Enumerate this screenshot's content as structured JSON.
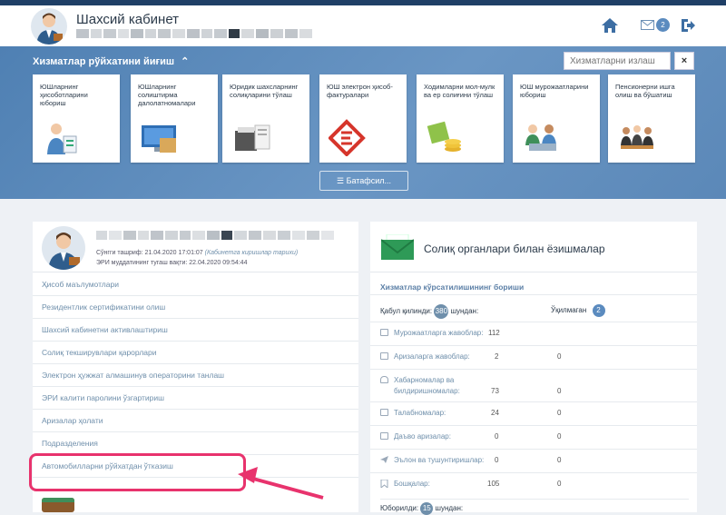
{
  "header": {
    "title": "Шахсий кабинет",
    "message_count": "2"
  },
  "banner": {
    "title": "Хизматлар рўйхатини йиғиш",
    "search_placeholder": "Хизматларни излаш",
    "close_label": "×",
    "more_label": "☰  Батафсил...",
    "cards": [
      {
        "label": "ЮШларнинг ҳисоботларини юбориш",
        "icon": "accountant-icon"
      },
      {
        "label": "ЮШларнинг солиштирма далолатномалари",
        "icon": "monitor-icon"
      },
      {
        "label": "Юридик шахсларнинг солиқларини тўлаш",
        "icon": "printer-icon"
      },
      {
        "label": "ЮШ электрон ҳисоб-фактуралари",
        "icon": "e-invoice-icon"
      },
      {
        "label": "Ходимларни мол-мулк ва ер солиғини тўлаш",
        "icon": "coins-icon"
      },
      {
        "label": "ЮШ мурожаатларини юбориш",
        "icon": "meeting-icon"
      },
      {
        "label": "Пенсионерни ишга олиш ва бўшатиш",
        "icon": "team-icon"
      }
    ]
  },
  "profile": {
    "last_visit": "Сўнгги ташриф: 21.04.2020 17:01:07",
    "last_visit_link": "(Кабинетга киришлар тарихи)",
    "eri_expiry": "ЭРИ муддатининг тугаш вақти: 22.04.2020 09:54:44"
  },
  "menu": [
    "Ҳисоб маълумотлари",
    "Резидентлик сертификатини олиш",
    "Шахсий кабинетни активлаштириш",
    "Солиқ текширувлари қарорлари",
    "Электрон ҳужжат алмашинув операторини танлаш",
    "ЭРИ калити паролини ўзгартириш",
    "Аризалар ҳолати",
    "Подразделения",
    "Автомобилларни рўйхатдан ўтказиш"
  ],
  "correspondence": {
    "title": "Солиқ органлари билан ёзишмалар",
    "subtitle": "Хизматлар кўрсатилишининг бориши",
    "received_label": "Қабул қилинди:",
    "received_count": "380",
    "of_which": "шундан:",
    "unread_label": "Ўқилмаган",
    "unread_count": "2",
    "rows": [
      {
        "label": "Мурожаатларга жавоблар:",
        "v1": "112",
        "v2": "",
        "icon": "envelope-icon"
      },
      {
        "label": "Аризаларга жавоблар:",
        "v1": "2",
        "v2": "0",
        "icon": "envelope-icon"
      },
      {
        "label": "Хабарномалар ва",
        "label2": "билдиришномалар:",
        "v1": "73",
        "v2": "0",
        "icon": "bell-icon"
      },
      {
        "label": "Талабномалар:",
        "v1": "24",
        "v2": "0",
        "icon": "megaphone-icon"
      },
      {
        "label": "Даъво аризалар:",
        "v1": "0",
        "v2": "0",
        "icon": "briefcase-icon"
      },
      {
        "label": "Эълон ва тушунтиришлар:",
        "v1": "0",
        "v2": "0",
        "icon": "send-icon"
      },
      {
        "label": "Бошқалар:",
        "v1": "105",
        "v2": "0",
        "icon": "bookmark-icon"
      }
    ],
    "sent_label": "Юборилди:",
    "sent_count": "15",
    "sent_of_which": "шундан:"
  }
}
